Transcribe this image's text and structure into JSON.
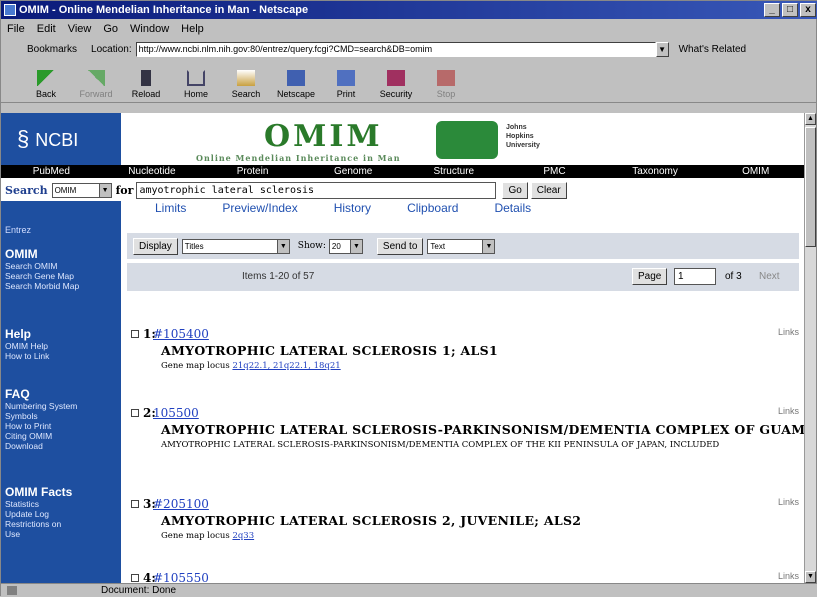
{
  "window": {
    "title": "OMIM - Online Mendelian Inheritance in Man - Netscape",
    "buttons": [
      "_",
      "□",
      "x"
    ]
  },
  "menu": [
    "File",
    "Edit",
    "View",
    "Go",
    "Window",
    "Help"
  ],
  "location": {
    "bookmarks": "Bookmarks",
    "label": "Location:",
    "url": "http://www.ncbi.nlm.nih.gov:80/entrez/query.fcgi?CMD=search&DB=omim",
    "related": "What's Related"
  },
  "toolbar": [
    "Back",
    "Forward",
    "Reload",
    "Home",
    "Search",
    "Netscape",
    "Print",
    "Security",
    "Stop"
  ],
  "header": {
    "ncbi": "NCBI",
    "omim": "OMIM",
    "omim_sub": "Online Mendelian Inheritance in Man",
    "jh_text": [
      "Johns",
      "Hopkins",
      "University"
    ]
  },
  "nav": [
    "PubMed",
    "Nucleotide",
    "Protein",
    "Genome",
    "Structure",
    "PMC",
    "Taxonomy",
    "OMIM"
  ],
  "search": {
    "label": "Search",
    "db": "OMIM",
    "for": "for",
    "query": "amyotrophic lateral sclerosis",
    "go": "Go",
    "clear": "Clear"
  },
  "tabs": [
    "Limits",
    "Preview/Index",
    "History",
    "Clipboard",
    "Details"
  ],
  "sidebar": {
    "entrez": "Entrez",
    "sections": [
      {
        "heading": "OMIM",
        "items": [
          "Search OMIM",
          "Search Gene Map",
          "Search Morbid Map"
        ]
      },
      {
        "heading": "Help",
        "items": [
          "OMIM Help",
          "How to Link"
        ]
      },
      {
        "heading": "FAQ",
        "items": [
          "Numbering System",
          "Symbols",
          "How to Print",
          "Citing OMIM",
          "Download"
        ]
      },
      {
        "heading": "OMIM Facts",
        "items": [
          "Statistics",
          "Update Log",
          "Restrictions on",
          "Use"
        ]
      }
    ]
  },
  "display": {
    "display_btn": "Display",
    "format": "Titles",
    "show_label": "Show:",
    "show_val": "20",
    "sendto_btn": "Send to",
    "sendto_val": "Text"
  },
  "pager": {
    "items": "Items 1-20 of 57",
    "page_btn": "Page",
    "page_val": "1",
    "of": "of 3",
    "next": "Next"
  },
  "results": [
    {
      "num": "1:",
      "id": "#105400",
      "title": "AMYOTROPHIC LATERAL SCLEROSIS 1; ALS1",
      "sub_label": "Gene map locus",
      "sub_link": "21q22.1, 21q22.1, 18q21",
      "links": "Links"
    },
    {
      "num": "2:",
      "id": "105500",
      "title": "AMYOTROPHIC LATERAL SCLEROSIS-PARKINSONISM/DEMENTIA COMPLEX OF GUAM",
      "sub_text": "AMYOTROPHIC LATERAL SCLEROSIS-PARKINSONISM/DEMENTIA COMPLEX OF THE KII PENINSULA OF JAPAN, INCLUDED",
      "links": "Links"
    },
    {
      "num": "3:",
      "id": "#205100",
      "title": "AMYOTROPHIC LATERAL SCLEROSIS 2, JUVENILE; ALS2",
      "sub_label": "Gene map locus",
      "sub_link": "2q33",
      "links": "Links"
    },
    {
      "num": "4:",
      "id": "#105550",
      "title": "",
      "links": "Links"
    }
  ],
  "status": "Document: Done"
}
